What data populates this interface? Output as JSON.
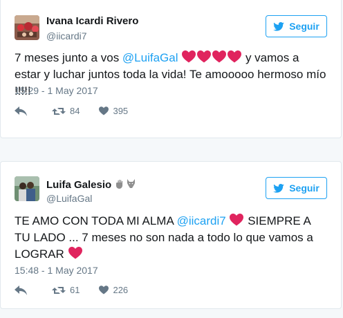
{
  "tweets": [
    {
      "name": "Ivana Icardi Rivero",
      "handle": "@iicardi7",
      "follow_label": "Seguir",
      "text_a": "7 meses junto a vos ",
      "mention": "@LuifaGal",
      "text_b": " y vamos a estar y luchar juntos toda la vida! Te amooooo hermoso mío !!!!!",
      "date": "15:29 - 1 May 2017",
      "retweets": "84",
      "likes": "395"
    },
    {
      "name": "Luifa Galesio",
      "handle": "@LuifaGal",
      "follow_label": "Seguir",
      "text_a": "TE AMO CON TODA MI ALMA ",
      "mention": "@iicardi7",
      "text_b": " SIEMPRE A TU LADO ... 7 meses no son nada a todo lo que vamos a LOGRAR",
      "date": "15:48 - 1 May 2017",
      "retweets": "61",
      "likes": "226"
    }
  ],
  "colors": {
    "accent": "#1da1f2",
    "heart": "#e0245e",
    "muted": "#657786",
    "text": "#14171a"
  },
  "icons": [
    "twitter-bird-icon",
    "heart-emoji-icon",
    "reply-icon",
    "retweet-icon",
    "like-icon",
    "raised-hand-icon",
    "wolf-icon"
  ]
}
